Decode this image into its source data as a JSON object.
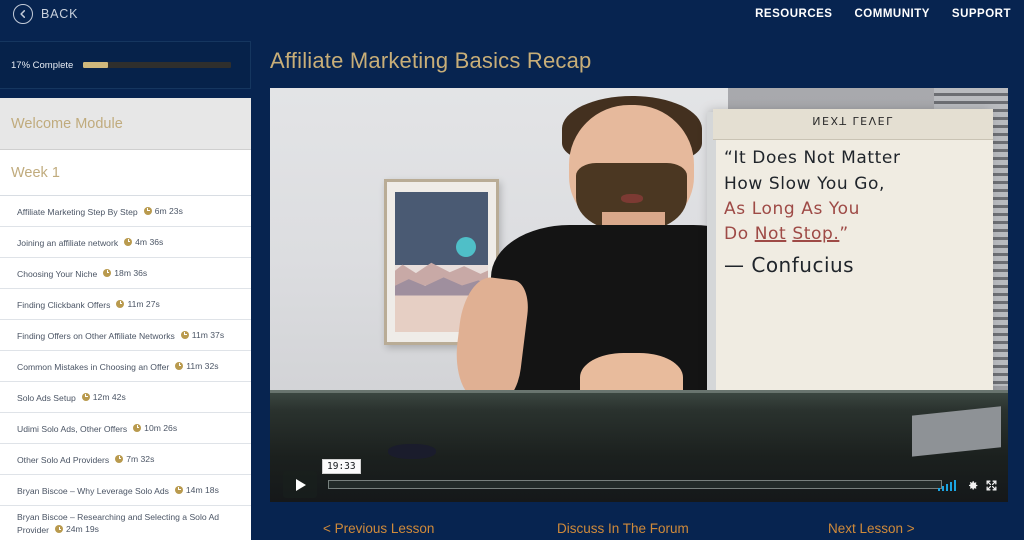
{
  "topbar": {
    "back_label": "BACK",
    "nav": [
      {
        "label": "RESOURCES"
      },
      {
        "label": "COMMUNITY"
      },
      {
        "label": "SUPPORT"
      }
    ]
  },
  "progress": {
    "label": "17% Complete",
    "percent": 17
  },
  "sidebar": {
    "module_label": "Welcome Module",
    "week_label": "Week 1",
    "lessons": [
      {
        "title": "Affiliate Marketing Step By Step",
        "duration": "6m 23s"
      },
      {
        "title": "Joining an affiliate network",
        "duration": "4m 36s"
      },
      {
        "title": "Choosing Your Niche",
        "duration": "18m 36s"
      },
      {
        "title": "Finding Clickbank Offers",
        "duration": "11m 27s"
      },
      {
        "title": "Finding Offers on Other Affiliate Networks",
        "duration": "11m 37s"
      },
      {
        "title": "Common Mistakes in Choosing an Offer",
        "duration": "11m 32s"
      },
      {
        "title": "Solo Ads Setup",
        "duration": "12m 42s"
      },
      {
        "title": "Udimi Solo Ads, Other Offers",
        "duration": "10m 26s"
      },
      {
        "title": "Other Solo Ad Providers",
        "duration": "7m 32s"
      },
      {
        "title": "Bryan Biscoe – Why Leverage Solo Ads",
        "duration": "14m 18s"
      },
      {
        "title": "Bryan Biscoe – Researching and Selecting a Solo Ad Provider",
        "duration": "24m 19s"
      }
    ]
  },
  "main": {
    "lesson_title": "Affiliate Marketing Basics Recap"
  },
  "video": {
    "current_time": "19:33",
    "flipchart": {
      "header": "NEXT LEVEL",
      "line1": "“It Does Not Matter",
      "line2": "How Slow You Go,",
      "line3": "As Long As You",
      "line4a": "Do ",
      "line4b": "Not",
      "line4c": " ",
      "line4d": "Stop.",
      "line4e": "”",
      "signature": "— Confucius"
    }
  },
  "footer": {
    "previous": "< Previous Lesson",
    "forum": "Discuss In The Forum",
    "next": "Next Lesson >"
  },
  "colors": {
    "navy": "#072450",
    "gold": "#c8ae78",
    "orange": "#d08a3a",
    "volume_blue": "#1ba4e2",
    "progress_fill": "#cfb87c"
  }
}
